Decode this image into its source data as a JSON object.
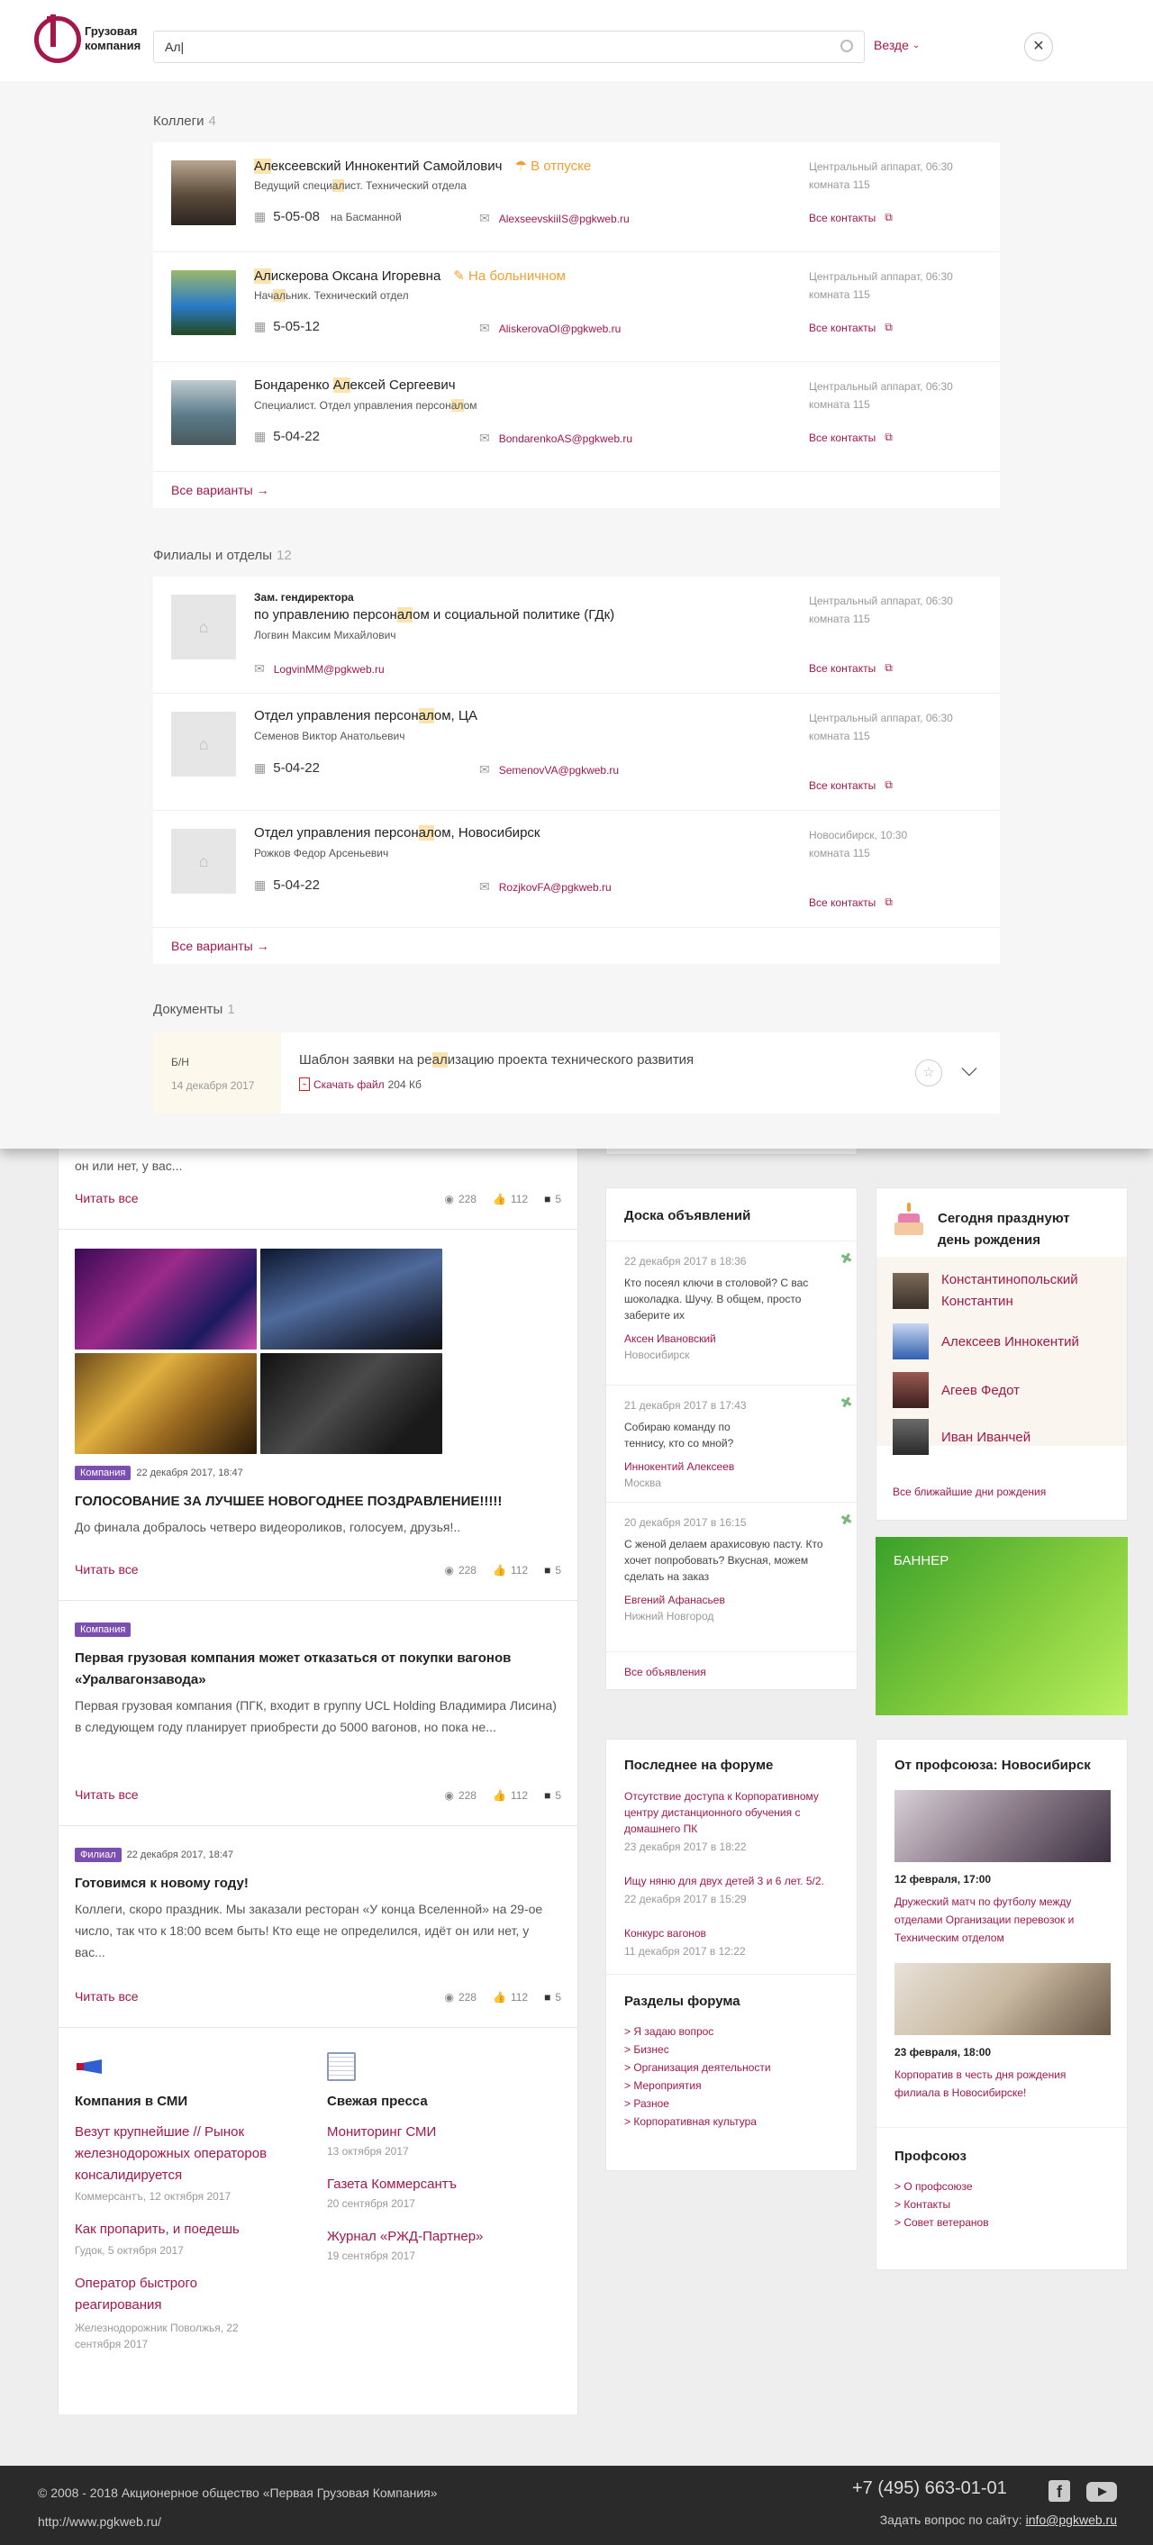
{
  "header": {
    "logo_line1": "Грузовая",
    "logo_line2": "компания",
    "search_value": "Ал|",
    "scope_label": "Везде"
  },
  "search": {
    "colleagues": {
      "title": "Коллеги",
      "count": "4",
      "more": "Все варианты →",
      "items": [
        {
          "name_pre": "",
          "name_hl": "Ал",
          "name_post": "ексеевский Иннокентий Самойлович",
          "status": "В отпуске",
          "status_color": "#f0a030",
          "role_pre": "Ведущий специ",
          "role_hl": "ал",
          "role_post": "ист. Технический отдела",
          "phone": "5-05-08",
          "phone_note": "на Басманной",
          "email": "AlexseevskiiIS@pgkweb.ru",
          "loc1": "Центральный аппарат, 06:30",
          "loc2": "комната 115",
          "all": "Все контакты"
        },
        {
          "name_pre": "",
          "name_hl": "Ал",
          "name_post": "искерова Оксана Игоревна",
          "status": "На больничном",
          "status_color": "#f0a030",
          "role_pre": "Нач",
          "role_hl": "ал",
          "role_post": "ьник. Технический отдел",
          "phone": "5-05-12",
          "phone_note": "",
          "email": "AliskerovaOI@pgkweb.ru",
          "loc1": "Центральный аппарат, 06:30",
          "loc2": "комната 115",
          "all": "Все контакты"
        },
        {
          "name_pre": "Бондаренко ",
          "name_hl": "Ал",
          "name_post": "ексей Сергеевич",
          "status": "",
          "status_color": "#f0a030",
          "role_pre": "Специалист. Отдел управления персон",
          "role_hl": "ал",
          "role_post": "ом",
          "phone": "5-04-22",
          "phone_note": "",
          "email": "BondarenkoAS@pgkweb.ru",
          "loc1": "Центральный аппарат, 06:30",
          "loc2": "комната 115",
          "all": "Все контакты"
        }
      ]
    },
    "branches": {
      "title": "Филиалы и отделы",
      "count": "12",
      "more": "Все варианты →",
      "items": [
        {
          "pre": "Зам. гендиректора",
          "name_pre": "по управлению персон",
          "name_hl": "ал",
          "name_post": "ом и социальной политике (ГДк)",
          "head": "Логвин Максим Михайлович",
          "phone": "",
          "email": "LogvinMM@pgkweb.ru",
          "loc1": "Центральный аппарат, 06:30",
          "loc2": "комната 115",
          "all": "Все контакты"
        },
        {
          "pre": "",
          "name_pre": "Отдел управления персон",
          "name_hl": "ал",
          "name_post": "ом, ЦА",
          "head": "Семенов Виктор Анатольевич",
          "phone": "5-04-22",
          "email": "SemenovVA@pgkweb.ru",
          "loc1": "Центральный аппарат, 06:30",
          "loc2": "комната 115",
          "all": "Все контакты"
        },
        {
          "pre": "",
          "name_pre": "Отдел управления персон",
          "name_hl": "ал",
          "name_post": "ом, Новосибирск",
          "head": "Рожков Федор Арсеньевич",
          "phone": "5-04-22",
          "email": "RozjkovFA@pgkweb.ru",
          "loc1": "Новосибирск, 10:30",
          "loc2": "комната 115",
          "all": "Все контакты"
        }
      ]
    },
    "documents": {
      "title": "Документы",
      "count": "1",
      "num": "Б/Н",
      "date": "14 декабря 2017",
      "name_pre": "Шаблон заявки на ре",
      "name_hl": "ал",
      "name_post": "изацию проекта технического развития",
      "download": "Скачать файл",
      "size": "204 Кб"
    }
  },
  "news": {
    "read_more": "Читать все",
    "n0": {
      "tail": "он или нет, у вас...",
      "views": "228",
      "likes": "112",
      "comments": "5"
    },
    "n1": {
      "tag": "Компания",
      "date": "22 декабря 2017, 18:47",
      "title": "ГОЛОСОВАНИЕ ЗА ЛУЧШЕЕ НОВОГОДНЕЕ ПОЗДРАВЛЕНИЕ!!!!!",
      "text": "До финала добралось четверо видеороликов, голосуем, друзья!..",
      "views": "228",
      "likes": "112",
      "comments": "5"
    },
    "n2": {
      "tag": "Компания",
      "title": "Первая грузовая компания может отказаться от покупки вагонов «Уралвагонзавода»",
      "text": "Первая грузовая компания (ПГК, входит в группу UCL Holding Владимира Лисина) в следующем году планирует приобрести до 5000 вагонов, но пока не...",
      "views": "228",
      "likes": "112",
      "comments": "5"
    },
    "n3": {
      "tag": "Филиал",
      "date": "22 декабря 2017, 18:47",
      "title": "Готовимся к новому году!",
      "text": "Коллеги, скоро праздник. Мы заказали ресторан «У конца Вселенной» на 29-ое число, так что к 18:00 всем быть! Кто еще не определился, идёт он или нет, у вас...",
      "views": "228",
      "likes": "112",
      "comments": "5"
    }
  },
  "media": {
    "title": "Компания в СМИ",
    "items": [
      {
        "title": "Везут крупнейшие // Рынок железнодорожных операторов консалидируется",
        "meta": "Коммерсантъ, 12 октября 2017"
      },
      {
        "title": "Как пропарить, и поедешь",
        "meta": "Гудок, 5 октября 2017"
      },
      {
        "title": "Оператор быстрого реагирования",
        "meta": "Железнодорожник Поволжья, 22 сентября 2017"
      }
    ]
  },
  "press": {
    "title": "Свежая пресса",
    "items": [
      {
        "title": "Мониторинг СМИ",
        "meta": "13 октября 2017"
      },
      {
        "title": "Газета Коммерсантъ",
        "meta": "20 сентября 2017"
      },
      {
        "title": "Журнал «РЖД-Партнер»",
        "meta": "19 сентября 2017"
      }
    ]
  },
  "ads": {
    "title": "Доска объявлений",
    "all": "Все объявления",
    "items": [
      {
        "date": "22 декабря 2017 в 18:36",
        "text": "Кто посеял ключи в столовой? С вас шоколадка. Шучу. В общем, просто заберите их",
        "author": "Аксен Ивановский",
        "city": "Новосибирск"
      },
      {
        "date": "21 декабря 2017 в 17:43",
        "text": "Собираю команду по теннису, кто со мной?",
        "author": "Иннокентий Алексеев",
        "city": "Москва"
      },
      {
        "date": "20 декабря 2017 в 16:15",
        "text": "С женой делаем арахисовую пасту. Кто хочет попробовать? Вкусная, можем сделать на заказ",
        "author": "Евгений Афанасьев",
        "city": "Нижний Новгород"
      }
    ]
  },
  "birthdays": {
    "title": "Сегодня празднуют день рождения",
    "all": "Все ближайшие дни рождения",
    "people": [
      "Константинопольский Константин",
      "Алексеев Иннокентий",
      "Агеев Федот",
      "Иван Иванчей"
    ]
  },
  "banner": {
    "label": "БАННЕР"
  },
  "forum": {
    "title": "Последнее на форуме",
    "items": [
      {
        "title": "Отсутствие доступа к Корпоративному центру дистанционного обучения с домашнего ПК",
        "date": "23 декабря 2017 в 18:22"
      },
      {
        "title": "Ищу няню для двух детей 3 и 6 лет. 5/2.",
        "date": "22 декабря 2017 в 15:29"
      },
      {
        "title": "Конкурс вагонов",
        "date": "11 декабря 2017 в 12:22"
      }
    ]
  },
  "forum_sections": {
    "title": "Разделы форума",
    "items": [
      "> Я задаю вопрос",
      "> Бизнес",
      "> Организация деятельности",
      "> Мероприятия",
      "> Разное",
      "> Корпоративная культура"
    ]
  },
  "union": {
    "title": "От профсоюза: Новосибирск",
    "items": [
      {
        "date": "12 февраля, 17:00",
        "text": "Дружеский матч по футболу между отделами Организации перевозок и Техническим отделом"
      },
      {
        "date": "23 февраля, 18:00",
        "text": "Корпоратив в честь дня рождения филиала в Новосибирске!"
      }
    ]
  },
  "union_links": {
    "title": "Профсоюз",
    "items": [
      "> О профсоюзе",
      "> Контакты",
      "> Совет ветеранов"
    ]
  },
  "footer": {
    "copyright": "© 2008 - 2018 Акционерное общество «Первая Грузовая Компания»",
    "url": "http://www.pgkweb.ru/",
    "phone": "+7 (495) 663-01-01",
    "ask": "Задать вопрос по сайту:",
    "email": "info@pgkweb.ru"
  },
  "colors": {
    "brand": "#a3174a",
    "tag_purple": "#7b4fb0",
    "highlight": "#fbe3b0",
    "status": "#f0a030"
  }
}
